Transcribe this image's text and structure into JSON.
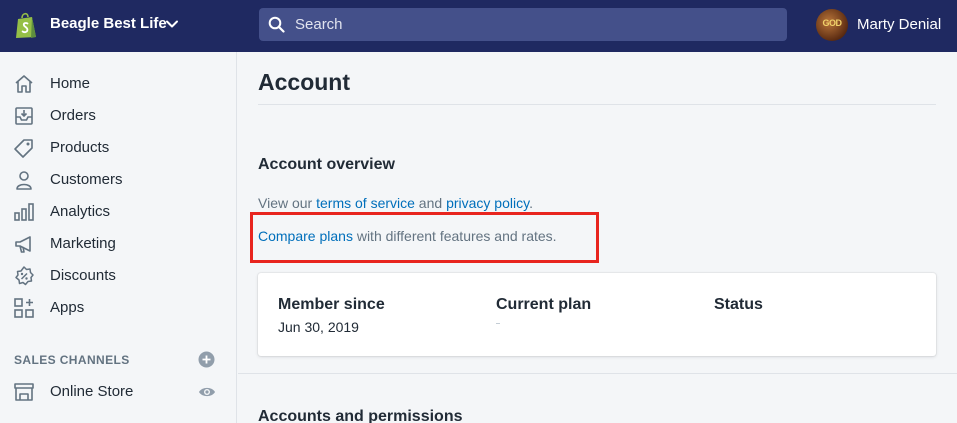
{
  "topbar": {
    "store_name": "Beagle Best Life",
    "search_placeholder": "Search",
    "user_name": "Marty Denial",
    "avatar_text": "GOD",
    "logo_icon": "shopify-bag-icon",
    "background": "#1f2961"
  },
  "sidebar": {
    "items": [
      {
        "label": "Home",
        "icon": "home-icon"
      },
      {
        "label": "Orders",
        "icon": "orders-icon"
      },
      {
        "label": "Products",
        "icon": "tag-icon"
      },
      {
        "label": "Customers",
        "icon": "person-icon"
      },
      {
        "label": "Analytics",
        "icon": "bar-chart-icon"
      },
      {
        "label": "Marketing",
        "icon": "megaphone-icon"
      },
      {
        "label": "Discounts",
        "icon": "discount-icon"
      },
      {
        "label": "Apps",
        "icon": "apps-icon"
      }
    ],
    "sales_channels_heading": "SALES CHANNELS",
    "channels": [
      {
        "label": "Online Store",
        "icon": "store-icon"
      }
    ]
  },
  "main": {
    "page_title": "Account",
    "overview": {
      "heading": "Account overview",
      "line1_prefix": "View our ",
      "terms_link": "terms of service",
      "line1_and": " and ",
      "privacy_link": "privacy policy",
      "line1_suffix": ".",
      "compare_link": "Compare plans",
      "line2_suffix": " with different features and rates."
    },
    "card": {
      "member_since_label": "Member since",
      "member_since_value": "Jun 30, 2019",
      "current_plan_label": "Current plan",
      "status_label": "Status"
    },
    "next_section_heading": "Accounts and permissions"
  },
  "colors": {
    "link": "#006fbb",
    "highlight": "#e8251f",
    "sidebar_bg": "#f4f6f8"
  }
}
